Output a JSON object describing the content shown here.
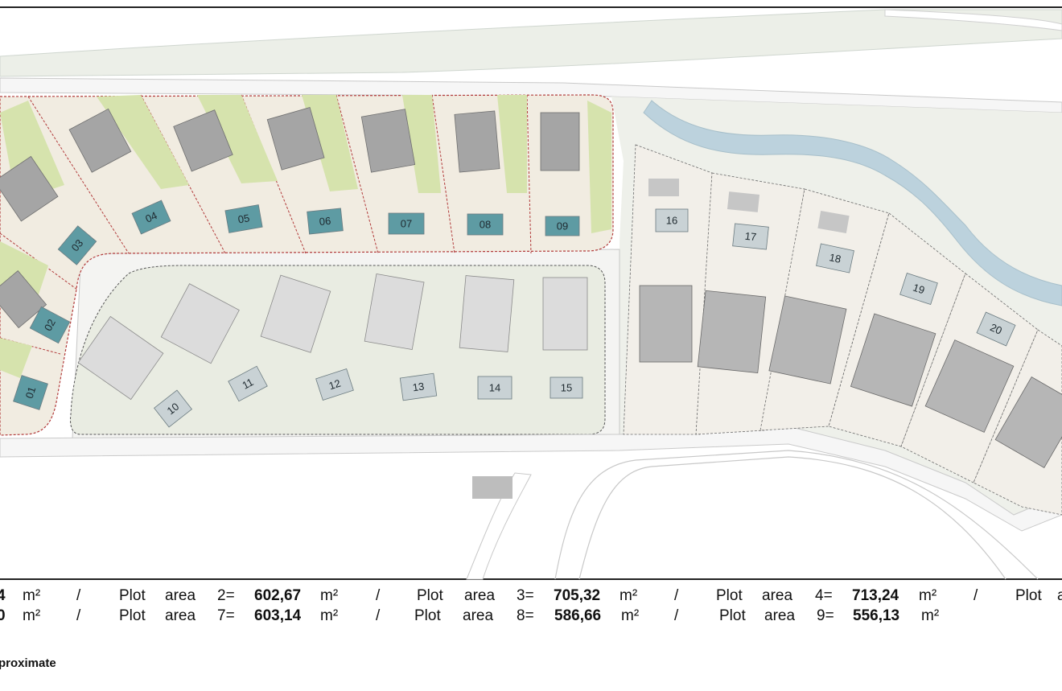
{
  "map": {
    "colors": {
      "background": "#ffffff",
      "road": "#f7f7f7",
      "greenery": "#d6e3ad",
      "light_green": "#e6ebdd",
      "pool_sold": "#5e9ba3",
      "pool_available": "#c9d2d5",
      "plot_outline": "#b23b3b",
      "river": "#bcd2dd",
      "house_roof": "#9b9b9b",
      "terrace": "#f3e4c5"
    },
    "plots": [
      {
        "label": "01",
        "group": "north"
      },
      {
        "label": "02",
        "group": "north"
      },
      {
        "label": "03",
        "group": "north"
      },
      {
        "label": "04",
        "group": "north"
      },
      {
        "label": "05",
        "group": "north"
      },
      {
        "label": "06",
        "group": "north"
      },
      {
        "label": "07",
        "group": "north"
      },
      {
        "label": "08",
        "group": "north"
      },
      {
        "label": "09",
        "group": "north"
      },
      {
        "label": "10",
        "group": "middle"
      },
      {
        "label": "11",
        "group": "middle"
      },
      {
        "label": "12",
        "group": "middle"
      },
      {
        "label": "13",
        "group": "middle"
      },
      {
        "label": "14",
        "group": "middle"
      },
      {
        "label": "15",
        "group": "middle"
      },
      {
        "label": "16",
        "group": "east"
      },
      {
        "label": "17",
        "group": "east"
      },
      {
        "label": "18",
        "group": "east"
      },
      {
        "label": "19",
        "group": "east"
      },
      {
        "label": "20",
        "group": "east"
      }
    ]
  },
  "legend": {
    "row1": [
      {
        "prefix": "4",
        "unit": "m²",
        "sep": "/"
      },
      {
        "word1": "Plot",
        "word2": "area",
        "idx": "2=",
        "value": "602,67",
        "unit": "m²",
        "sep": "/"
      },
      {
        "word1": "Plot",
        "word2": "area",
        "idx": "3=",
        "value": "705,32",
        "unit": "m²",
        "sep": "/"
      },
      {
        "word1": "Plot",
        "word2": "area",
        "idx": "4=",
        "value": "713,24",
        "unit": "m²",
        "sep": "/"
      },
      {
        "word1": "Plot",
        "word2": "a"
      }
    ],
    "row2": [
      {
        "prefix": "0",
        "unit": "m²",
        "sep": "/"
      },
      {
        "word1": "Plot",
        "word2": "area",
        "idx": "7=",
        "value": "603,14",
        "unit": "m²",
        "sep": "/"
      },
      {
        "word1": "Plot",
        "word2": "area",
        "idx": "8=",
        "value": "586,66",
        "unit": "m²",
        "sep": "/"
      },
      {
        "word1": "Plot",
        "word2": "area",
        "idx": "9=",
        "value": "556,13",
        "unit": "m²"
      }
    ],
    "footnote": "proximate"
  }
}
